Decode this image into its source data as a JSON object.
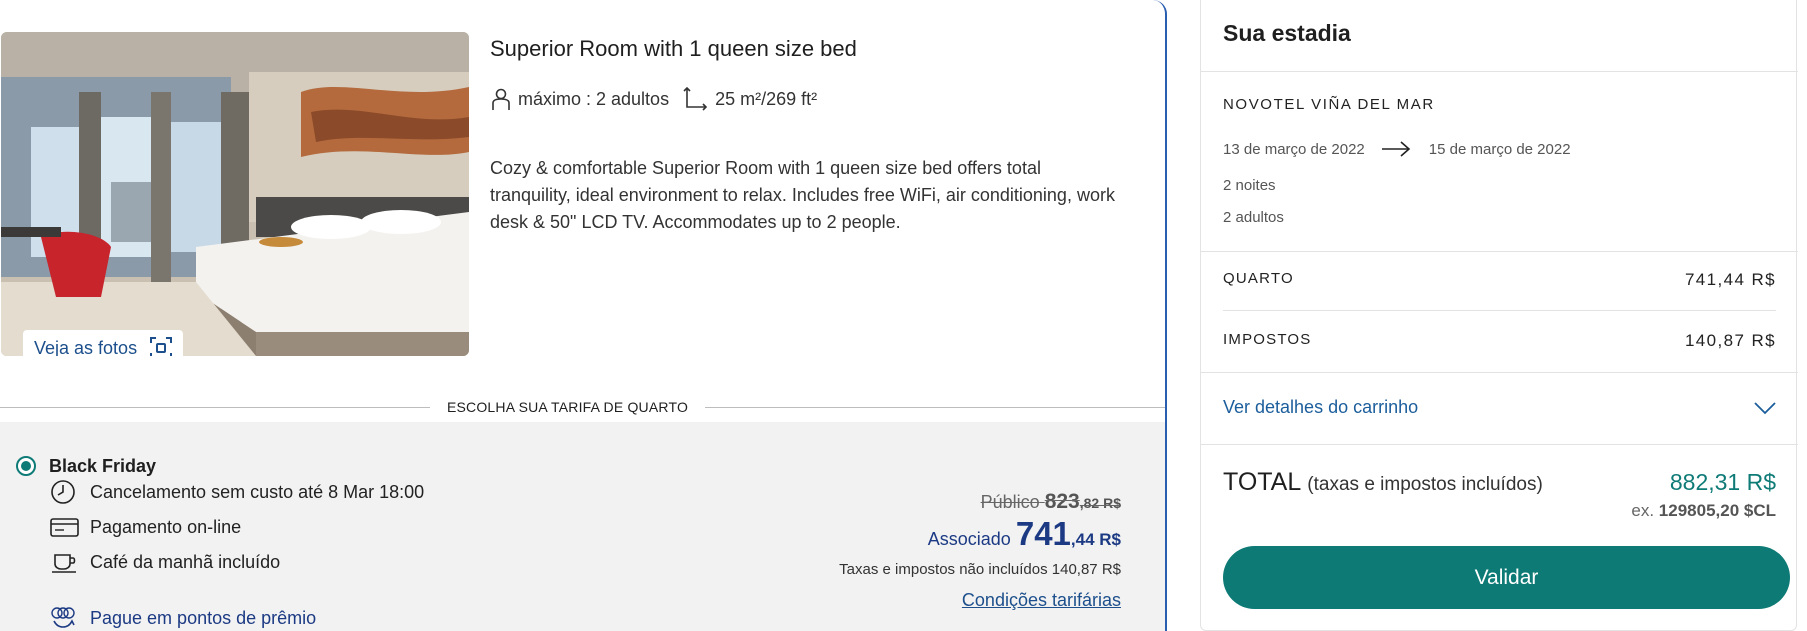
{
  "room": {
    "title": "Superior Room with 1 queen size bed",
    "max_occupancy": "máximo : 2 adultos",
    "size": "25 m²/269 ft²",
    "description": "Cozy & comfortable Superior Room with 1 queen size bed offers total tranquility, ideal environment to relax. Includes free WiFi, air conditioning, work desk & 50\" LCD TV. Accommodates up to 2 people.",
    "photos_button": "Veja as fotos"
  },
  "rate_section_label": "ESCOLHA SUA TARIFA DE QUARTO",
  "rate": {
    "name": "Black Friday",
    "perks": {
      "cancellation": "Cancelamento sem custo até 8 Mar 18:00",
      "payment": "Pagamento on-line",
      "breakfast": "Café da manhã incluído"
    },
    "points_link": "Pague em pontos de prêmio",
    "public_label": "Público",
    "public_int": "823",
    "public_dec": ",82 R$",
    "member_label": "Associado",
    "member_int": "741",
    "member_dec": ",44 R$",
    "taxes_note": "Taxas e impostos não incluídos 140,87 R$",
    "conditions_link": "Condições tarifárias"
  },
  "summary": {
    "title": "Sua estadia",
    "hotel": "NOVOTEL VIÑA DEL MAR",
    "date_from": "13 de março de 2022",
    "date_to": "15 de março de 2022",
    "nights": "2 noites",
    "adults": "2 adultos",
    "room_label": "QUARTO",
    "room_amount": "741,44 R$",
    "taxes_label": "IMPOSTOS",
    "taxes_amount": "140,87 R$",
    "cart_details": "Ver detalhes do carrinho",
    "total_label": "TOTAL",
    "total_note": "(taxas e impostos incluídos)",
    "total_amount": "882,31 R$",
    "total_ex_prefix": "ex.",
    "total_ex_value": "129805,20 $CL",
    "validate_button": "Validar"
  },
  "colors": {
    "accent_teal": "#0d7a75",
    "link_blue": "#1c5e9c",
    "member_navy": "#1c3a84",
    "card_border": "#2a5fb0"
  },
  "icons": [
    "person-icon",
    "room-size-icon",
    "gallery-icon",
    "clock-icon",
    "credit-card-icon",
    "coffee-cup-icon",
    "reward-points-icon",
    "arrow-right-icon",
    "chevron-down-icon"
  ]
}
